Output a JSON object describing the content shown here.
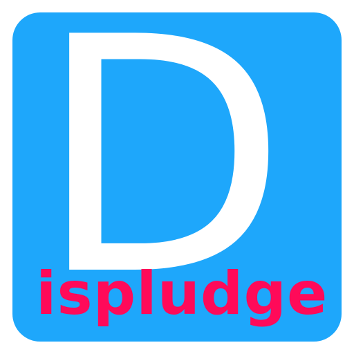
{
  "logo": {
    "letter": "D",
    "word": "ispludge",
    "colors": {
      "tile": "#1ea7fb",
      "letter": "#ffffff",
      "word": "#ff0a59"
    }
  }
}
